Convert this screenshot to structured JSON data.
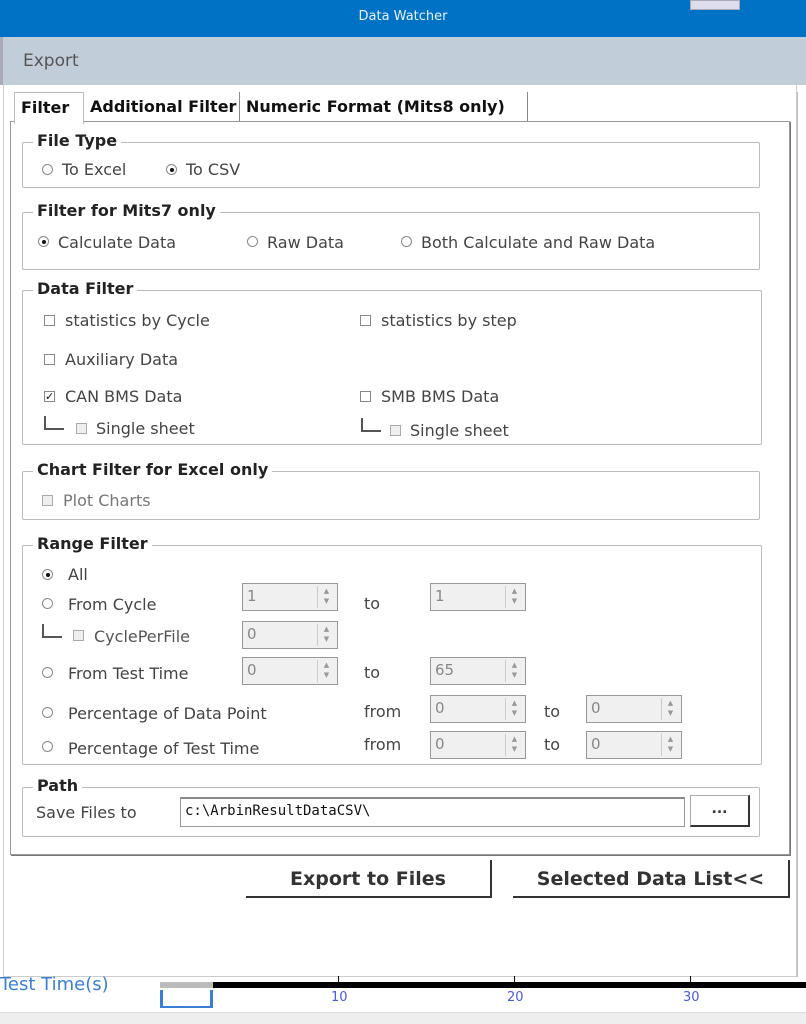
{
  "window": {
    "title": "Data Watcher"
  },
  "header": {
    "title": "Export"
  },
  "tabs": [
    {
      "label": "Filter",
      "selected": true
    },
    {
      "label": "Additional Filter"
    },
    {
      "label": "Numeric Format (Mits8 only)"
    }
  ],
  "file_type": {
    "legend": "File Type",
    "options": [
      {
        "label": "To Excel",
        "checked": false
      },
      {
        "label": "To CSV",
        "checked": true
      }
    ]
  },
  "mits7": {
    "legend": "Filter for Mits7 only",
    "options": [
      {
        "label": "Calculate Data",
        "checked": true
      },
      {
        "label": "Raw Data",
        "checked": false
      },
      {
        "label": "Both Calculate and Raw Data",
        "checked": false
      }
    ]
  },
  "data_filter": {
    "legend": "Data Filter",
    "stats_cycle": "statistics by Cycle",
    "stats_step": "statistics by step",
    "aux": "Auxiliary Data",
    "can_bms": "CAN BMS Data",
    "can_bms_checked": true,
    "can_single": "Single sheet",
    "smb_bms": "SMB BMS Data",
    "smb_single": "Single sheet"
  },
  "chart_filter": {
    "legend": "Chart Filter for Excel only",
    "plot": "Plot Charts"
  },
  "range_filter": {
    "legend": "Range Filter",
    "all": "All",
    "from_cycle": "From Cycle",
    "cycle_from": "1",
    "cycle_to": "1",
    "cycle_per_file": "CyclePerFile",
    "cycle_per_file_value": "0",
    "from_test_time": "From Test Time",
    "time_from": "0",
    "time_to": "65",
    "pct_data_point": "Percentage of Data Point",
    "pct_dp_from": "0",
    "pct_dp_to": "0",
    "pct_test_time": "Percentage of Test Time",
    "pct_tt_from": "0",
    "pct_tt_to": "0",
    "to": "to",
    "from": "from"
  },
  "path": {
    "legend": "Path",
    "label": "Save Files to",
    "value": "c:\\ArbinResultDataCSV\\",
    "browse": "..."
  },
  "buttons": {
    "export": "Export to Files",
    "selected_list": "Selected Data List<<"
  },
  "axis": {
    "label": "Test Time(s)",
    "ticks": [
      "10",
      "20",
      "30"
    ]
  }
}
